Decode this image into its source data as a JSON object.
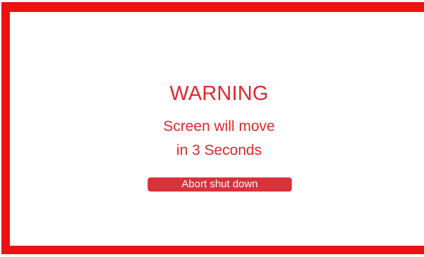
{
  "dialog": {
    "title": "WARNING",
    "message_line1": "Screen will move",
    "message_line2": "in 3 Seconds",
    "abort_button_label": "Abort shut down"
  },
  "colors": {
    "frame": "#ee1111",
    "text": "#e3262b",
    "button_bg": "#d8323a",
    "button_text": "#ffffff",
    "background": "#ffffff"
  }
}
